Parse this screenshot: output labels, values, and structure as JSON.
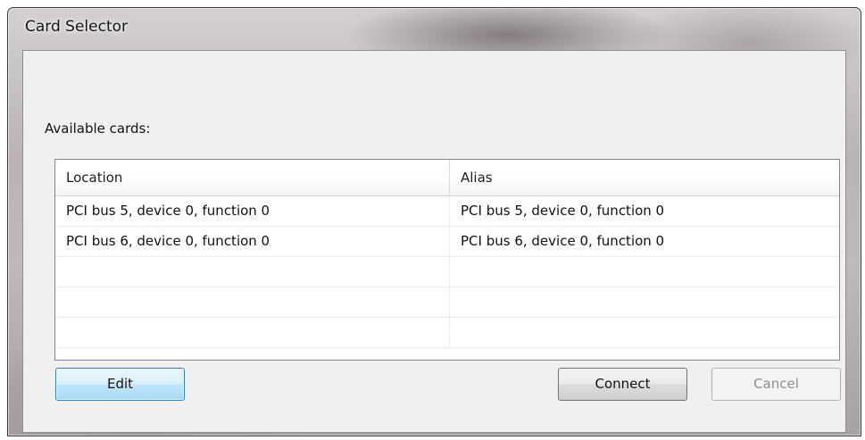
{
  "window": {
    "title": "Card Selector"
  },
  "dialog": {
    "available_label": "Available cards:",
    "columns": [
      "Location",
      "Alias"
    ],
    "rows": [
      {
        "location": "PCI bus 5, device 0, function 0",
        "alias": "PCI bus 5, device 0, function 0"
      },
      {
        "location": "PCI bus 6, device 0, function 0",
        "alias": "PCI bus 6, device 0, function 0"
      },
      {
        "location": "",
        "alias": ""
      },
      {
        "location": "",
        "alias": ""
      },
      {
        "location": "",
        "alias": ""
      }
    ],
    "buttons": {
      "edit": "Edit",
      "connect": "Connect",
      "cancel": "Cancel"
    }
  },
  "colors": {
    "client_background": "#f0f0f0",
    "edit_button_highlight": "#bee6fd",
    "disabled_text": "#8d8d8d"
  }
}
